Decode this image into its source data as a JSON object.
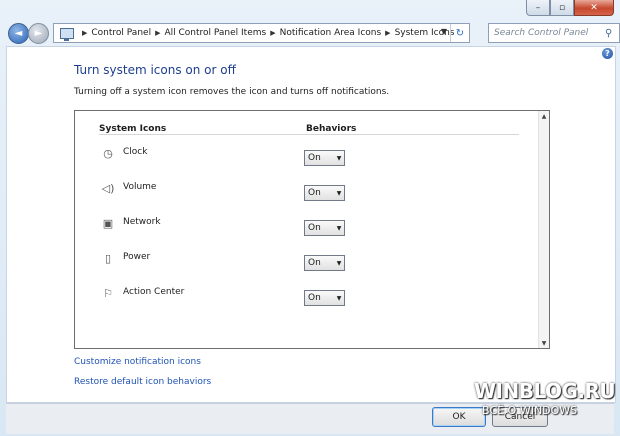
{
  "window": {
    "controls": {
      "minimize": "–",
      "maximize": "▫",
      "close": "✕"
    }
  },
  "nav": {
    "breadcrumb": [
      "Control Panel",
      "All Control Panel Items",
      "Notification Area Icons",
      "System Icons"
    ],
    "search_placeholder": "Search Control Panel"
  },
  "main": {
    "title": "Turn system icons on or off",
    "description": "Turning off a system icon removes the icon and turns off notifications.",
    "columns": {
      "icons": "System Icons",
      "behaviors": "Behaviors"
    },
    "rows": [
      {
        "label": "Clock",
        "icon": "clock-icon",
        "value": "On"
      },
      {
        "label": "Volume",
        "icon": "volume-icon",
        "value": "On"
      },
      {
        "label": "Network",
        "icon": "network-icon",
        "value": "On"
      },
      {
        "label": "Power",
        "icon": "power-icon",
        "value": "On"
      },
      {
        "label": "Action Center",
        "icon": "flag-icon",
        "value": "On"
      }
    ],
    "links": {
      "customize": "Customize notification icons",
      "restore": "Restore default icon behaviors"
    }
  },
  "buttons": {
    "ok": "OK",
    "cancel": "Cancel"
  },
  "watermark": {
    "main": "WINBLOG.RU",
    "sub": "ВСЁ О WINDOWS"
  },
  "colors": {
    "title": "#1e3f8f",
    "link": "#1f53b5",
    "accent": "#2b63b5"
  }
}
